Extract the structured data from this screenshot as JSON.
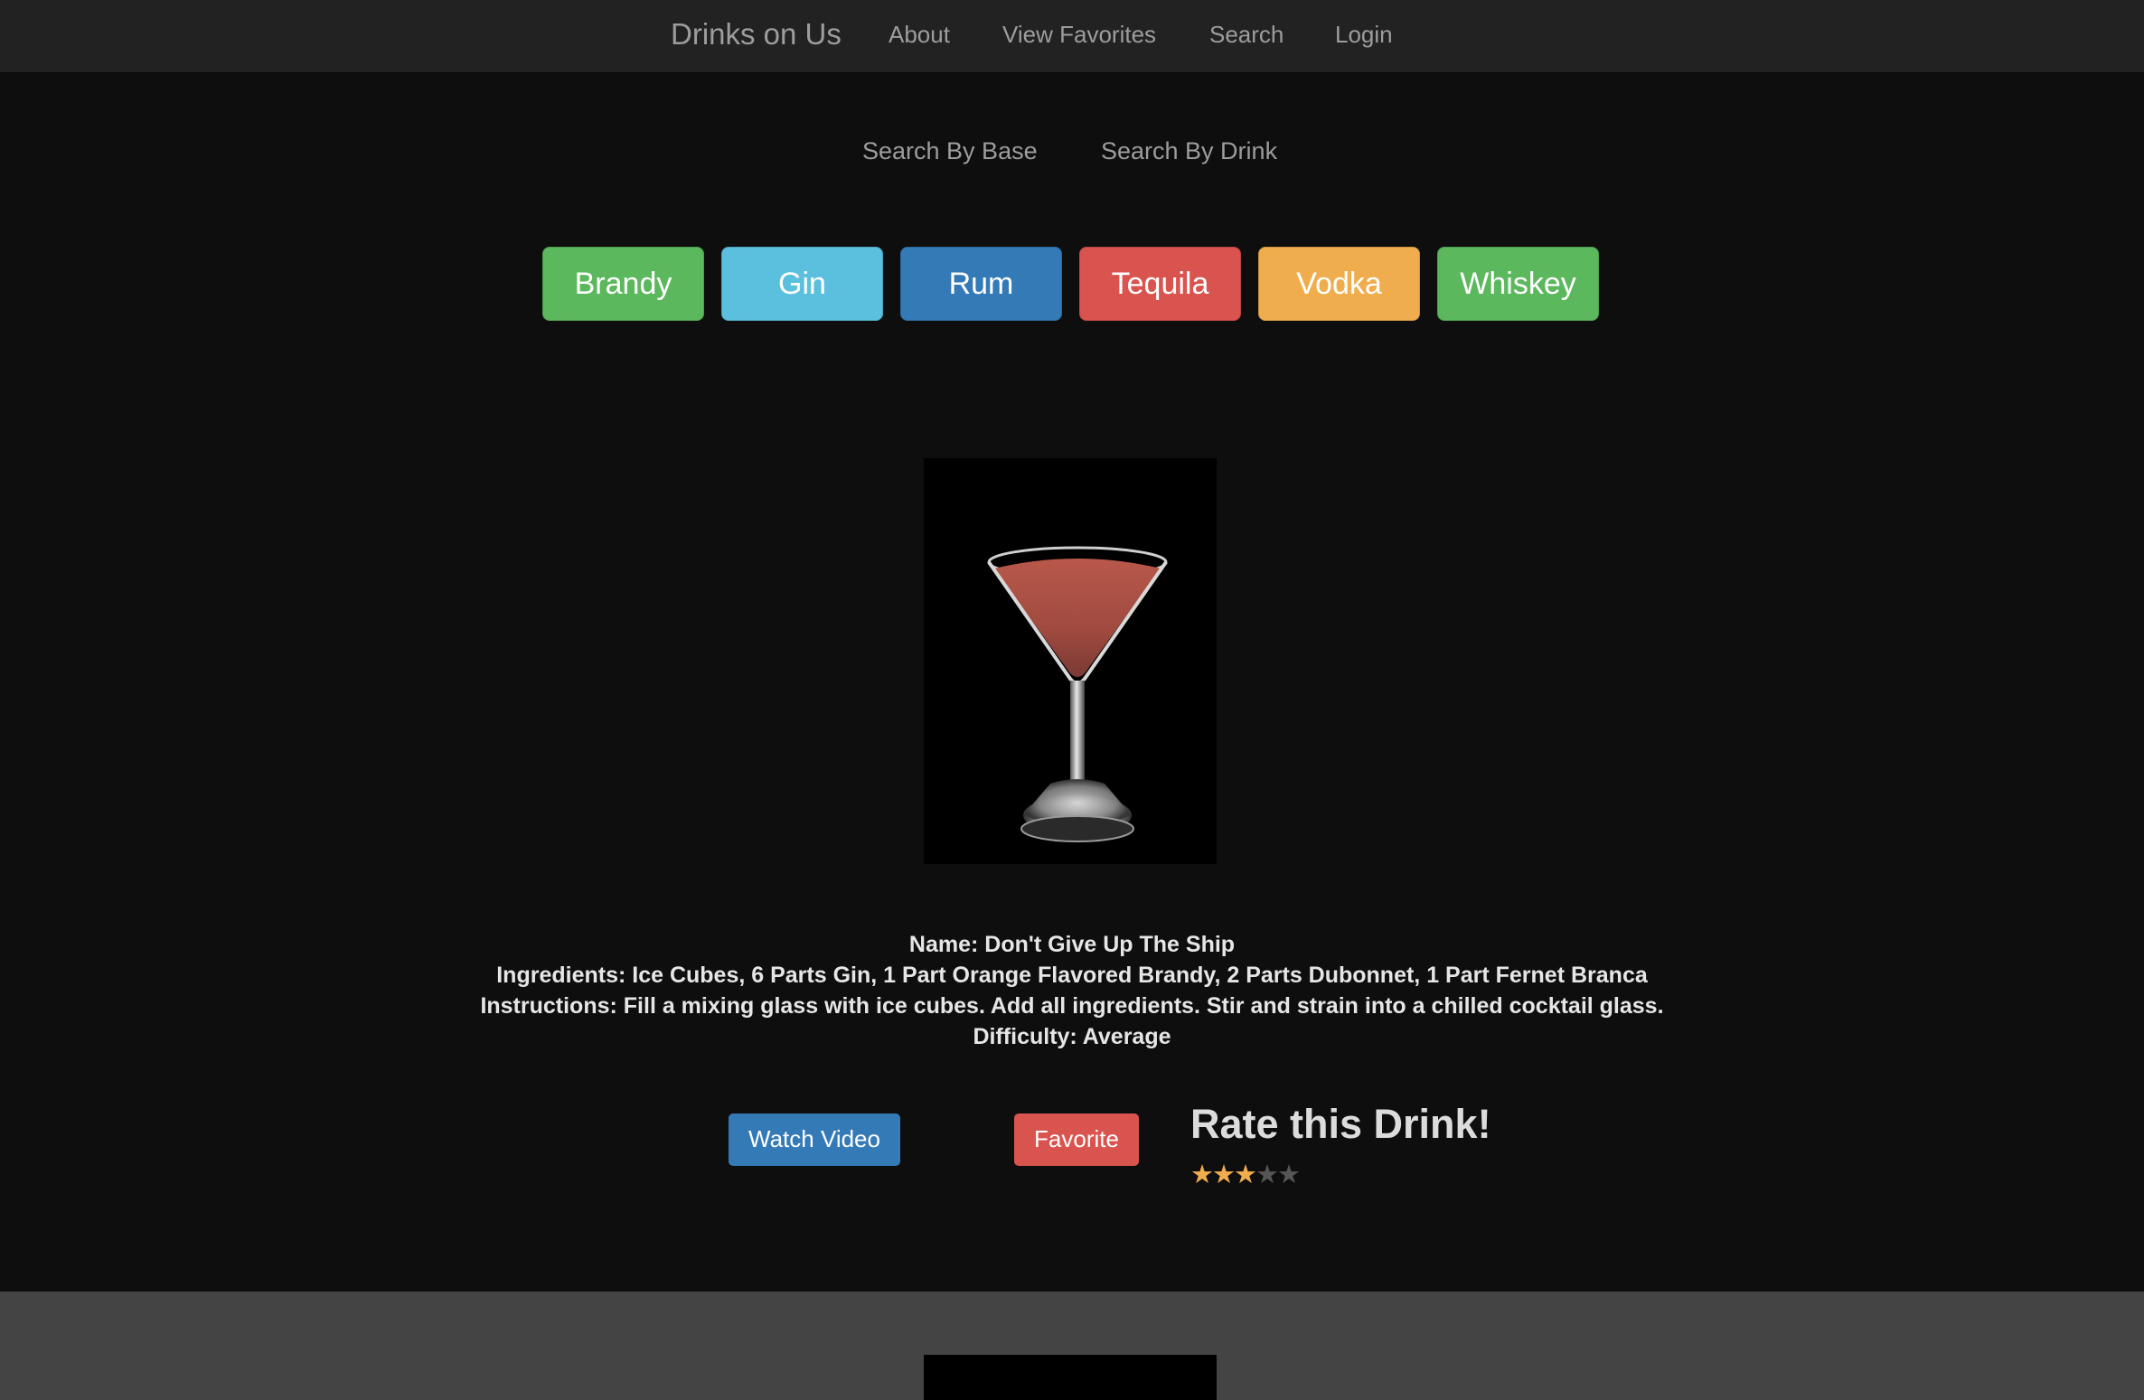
{
  "navbar": {
    "brand": "Drinks on Us",
    "links": [
      {
        "label": "About"
      },
      {
        "label": "View Favorites"
      },
      {
        "label": "Search"
      },
      {
        "label": "Login"
      }
    ]
  },
  "search_modes": [
    {
      "label": "Search By Base"
    },
    {
      "label": "Search By Drink"
    }
  ],
  "bases": [
    {
      "label": "Brandy",
      "color": "#5cb85c"
    },
    {
      "label": "Gin",
      "color": "#5bc0de"
    },
    {
      "label": "Rum",
      "color": "#337ab7"
    },
    {
      "label": "Tequila",
      "color": "#d9534f"
    },
    {
      "label": "Vodka",
      "color": "#f0ad4e"
    },
    {
      "label": "Whiskey",
      "color": "#5cb85c"
    }
  ],
  "drink": {
    "name_line": "Name: Don't Give Up The Ship",
    "ingredients_line": "Ingredients: Ice Cubes, 6 Parts Gin, 1 Part Orange Flavored Brandy, 2 Parts Dubonnet, 1 Part Fernet Branca",
    "instructions_line": "Instructions: Fill a mixing glass with ice cubes. Add all ingredients. Stir and strain into a chilled cocktail glass.",
    "difficulty_line": "Difficulty: Average",
    "image_icon": "cocktail-glass"
  },
  "actions": {
    "watch_video_label": "Watch Video",
    "watch_video_color": "#337ab7",
    "favorite_label": "Favorite",
    "favorite_color": "#d9534f"
  },
  "rating": {
    "title": "Rate this Drink!",
    "value": 3,
    "max": 5,
    "glyph": "★"
  }
}
